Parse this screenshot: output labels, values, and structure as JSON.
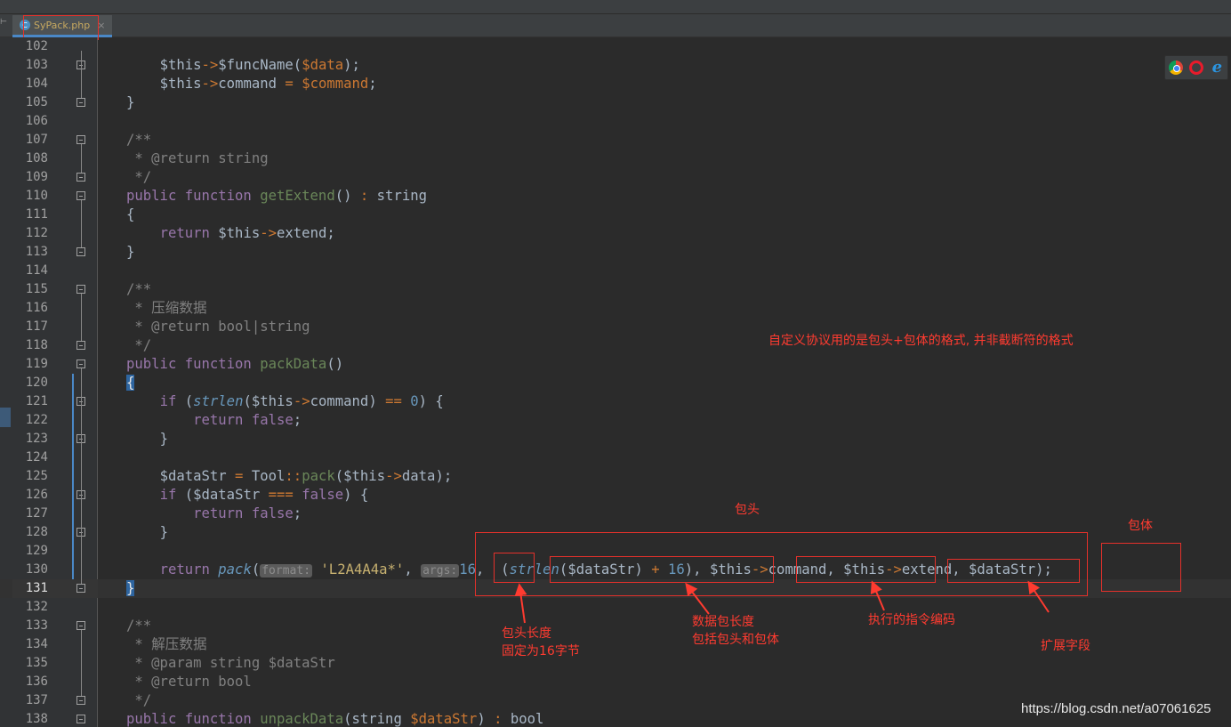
{
  "tab": {
    "file_icon": "php-file-icon",
    "file_name": "SyPack.php",
    "close": "×"
  },
  "colors": {
    "background": "#2b2b2b",
    "keyword": "#cc7832",
    "variable": "#9876aa",
    "function": "#ffc66d",
    "comment": "#808080",
    "string": "#6a8759",
    "number": "#6897bb",
    "annotation": "#e4312b"
  },
  "browser_icons": [
    "chrome-icon",
    "opera-icon",
    "ie-icon"
  ],
  "code_lines": [
    {
      "ln": "102",
      "segs": []
    },
    {
      "ln": "103",
      "segs": [
        [
          "    ",
          "t"
        ],
        [
          "$this",
          "t"
        ],
        [
          "->",
          "o"
        ],
        [
          "$funcName",
          "t"
        ],
        [
          "(",
          "t"
        ],
        [
          "$data",
          "k"
        ],
        [
          ");",
          "t"
        ]
      ]
    },
    {
      "ln": "104",
      "segs": [
        [
          "    ",
          "t"
        ],
        [
          "$this",
          "t"
        ],
        [
          "->",
          "o"
        ],
        [
          "command",
          "t"
        ],
        [
          " = ",
          "o"
        ],
        [
          "$command",
          "k"
        ],
        [
          ";",
          "t"
        ]
      ]
    },
    {
      "ln": "105",
      "segs": [
        [
          "}",
          "t"
        ]
      ]
    },
    {
      "ln": "106",
      "segs": []
    },
    {
      "ln": "107",
      "segs": [
        [
          "/**",
          "c"
        ]
      ]
    },
    {
      "ln": "108",
      "segs": [
        [
          " * @return string",
          "c"
        ]
      ]
    },
    {
      "ln": "109",
      "segs": [
        [
          " */",
          "c"
        ]
      ]
    },
    {
      "ln": "110",
      "segs": [
        [
          "public ",
          "v"
        ],
        [
          "function ",
          "v"
        ],
        [
          "getExtend",
          "s"
        ],
        [
          "() ",
          "t"
        ],
        [
          ": ",
          "o"
        ],
        [
          "string",
          "t"
        ]
      ]
    },
    {
      "ln": "111",
      "segs": [
        [
          "{",
          "t"
        ]
      ]
    },
    {
      "ln": "112",
      "segs": [
        [
          "    ",
          "t"
        ],
        [
          "return ",
          "v"
        ],
        [
          "$this",
          "t"
        ],
        [
          "->",
          "o"
        ],
        [
          "extend",
          "t"
        ],
        [
          ";",
          "t"
        ]
      ]
    },
    {
      "ln": "113",
      "segs": [
        [
          "}",
          "t"
        ]
      ]
    },
    {
      "ln": "114",
      "segs": []
    },
    {
      "ln": "115",
      "segs": [
        [
          "/**",
          "c"
        ]
      ]
    },
    {
      "ln": "116",
      "segs": [
        [
          " * 压缩数据",
          "c"
        ]
      ]
    },
    {
      "ln": "117",
      "segs": [
        [
          " * @return bool|string",
          "c"
        ]
      ]
    },
    {
      "ln": "118",
      "segs": [
        [
          " */",
          "c"
        ]
      ]
    },
    {
      "ln": "119",
      "segs": [
        [
          "public ",
          "v"
        ],
        [
          "function ",
          "v"
        ],
        [
          "packData",
          "s"
        ],
        [
          "()",
          "t"
        ]
      ]
    },
    {
      "ln": "120",
      "segs": [
        [
          "{",
          "brace-sel"
        ]
      ]
    },
    {
      "ln": "121",
      "segs": [
        [
          "    ",
          "t"
        ],
        [
          "if ",
          "v"
        ],
        [
          "(",
          "t"
        ],
        [
          "strlen",
          "i"
        ],
        [
          "(",
          "t"
        ],
        [
          "$this",
          "t"
        ],
        [
          "->",
          "o"
        ],
        [
          "command",
          "t"
        ],
        [
          ") ",
          "t"
        ],
        [
          "== ",
          "o"
        ],
        [
          "0",
          "n"
        ],
        [
          ") {",
          "t"
        ]
      ]
    },
    {
      "ln": "122",
      "segs": [
        [
          "        ",
          "t"
        ],
        [
          "return ",
          "v"
        ],
        [
          "false",
          "v"
        ],
        [
          ";",
          "t"
        ]
      ]
    },
    {
      "ln": "123",
      "segs": [
        [
          "    ",
          "t"
        ],
        [
          "}",
          "t"
        ]
      ]
    },
    {
      "ln": "124",
      "segs": []
    },
    {
      "ln": "125",
      "segs": [
        [
          "    ",
          "t"
        ],
        [
          "$dataStr",
          "t"
        ],
        [
          " = ",
          "o"
        ],
        [
          "Tool",
          "t"
        ],
        [
          "::",
          "o"
        ],
        [
          "pack",
          "s"
        ],
        [
          "(",
          "t"
        ],
        [
          "$this",
          "t"
        ],
        [
          "->",
          "o"
        ],
        [
          "data",
          "t"
        ],
        [
          ");",
          "t"
        ]
      ]
    },
    {
      "ln": "126",
      "segs": [
        [
          "    ",
          "t"
        ],
        [
          "if ",
          "v"
        ],
        [
          "(",
          "t"
        ],
        [
          "$dataStr",
          "t"
        ],
        [
          " === ",
          "o"
        ],
        [
          "false",
          "v"
        ],
        [
          ") {",
          "t"
        ]
      ]
    },
    {
      "ln": "127",
      "segs": [
        [
          "        ",
          "t"
        ],
        [
          "return ",
          "v"
        ],
        [
          "false",
          "v"
        ],
        [
          ";",
          "t"
        ]
      ]
    },
    {
      "ln": "128",
      "segs": [
        [
          "    ",
          "t"
        ],
        [
          "}",
          "t"
        ]
      ]
    },
    {
      "ln": "129",
      "segs": []
    },
    {
      "ln": "130",
      "segs": [
        [
          "    ",
          "t"
        ],
        [
          "return ",
          "v"
        ],
        [
          "pack",
          "i"
        ],
        [
          "(",
          "t"
        ],
        [
          "format:",
          "hint"
        ],
        [
          " ",
          "t"
        ],
        [
          "'L2A4A4a*'",
          "str-y"
        ],
        [
          ", ",
          "t"
        ],
        [
          "args:",
          "hint"
        ],
        [
          "16",
          "n"
        ],
        [
          ", ",
          "t"
        ],
        [
          " (",
          "t"
        ],
        [
          "strlen",
          "i"
        ],
        [
          "(",
          "t"
        ],
        [
          "$dataStr",
          "t"
        ],
        [
          ") ",
          "t"
        ],
        [
          "+ ",
          "o"
        ],
        [
          "16",
          "n"
        ],
        [
          "), ",
          "t"
        ],
        [
          "$this",
          "t"
        ],
        [
          "->",
          "o"
        ],
        [
          "command",
          "t"
        ],
        [
          ", ",
          "t"
        ],
        [
          "$this",
          "t"
        ],
        [
          "->",
          "o"
        ],
        [
          "extend",
          "t"
        ],
        [
          ", ",
          "t"
        ],
        [
          "$dataStr",
          "t"
        ],
        [
          ");",
          "t"
        ]
      ]
    },
    {
      "ln": "131",
      "segs": [
        [
          "}",
          "brace-sel"
        ]
      ]
    },
    {
      "ln": "132",
      "segs": []
    },
    {
      "ln": "133",
      "segs": [
        [
          "/**",
          "c"
        ]
      ]
    },
    {
      "ln": "134",
      "segs": [
        [
          " * 解压数据",
          "c"
        ]
      ]
    },
    {
      "ln": "135",
      "segs": [
        [
          " * @param string $dataStr",
          "c"
        ]
      ]
    },
    {
      "ln": "136",
      "segs": [
        [
          " * @return bool",
          "c"
        ]
      ]
    },
    {
      "ln": "137",
      "segs": [
        [
          " */",
          "c"
        ]
      ]
    },
    {
      "ln": "138",
      "segs": [
        [
          "public ",
          "v"
        ],
        [
          "function ",
          "v"
        ],
        [
          "unpackData",
          "s"
        ],
        [
          "(",
          "t"
        ],
        [
          "string ",
          "t"
        ],
        [
          "$dataStr",
          "k"
        ],
        [
          ") ",
          "t"
        ],
        [
          ": ",
          "o"
        ],
        [
          "bool",
          "t"
        ]
      ]
    }
  ],
  "annotations": {
    "format_note": "自定义协议用的是包头+包体的格式, 并非截断符的格式",
    "header": "包头",
    "body": "包体",
    "header_length": "包头长度\n固定为16字节",
    "packet_length": "数据包长度\n包括包头和包体",
    "command_code": "执行的指令编码",
    "extend_field": "扩展字段"
  },
  "watermark": "https://blog.csdn.net/a07061625"
}
